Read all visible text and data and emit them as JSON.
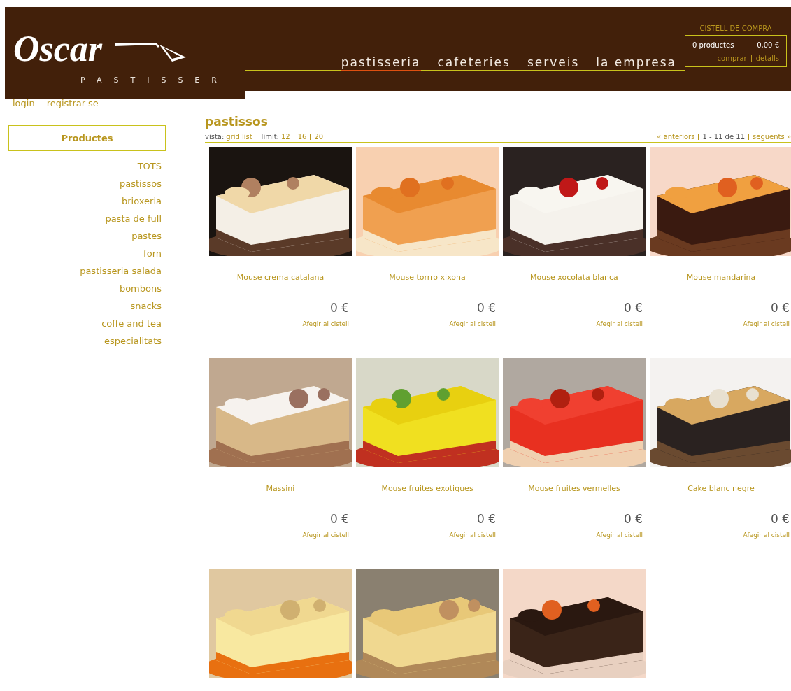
{
  "header": {
    "logo": {
      "name": "Oscar",
      "tagline": "PASTISSER"
    },
    "nav": [
      {
        "label": "pastisseria",
        "selected": true
      },
      {
        "label": "cafeteries",
        "selected": false
      },
      {
        "label": "serveis",
        "selected": false
      },
      {
        "label": "la empresa",
        "selected": false
      }
    ],
    "cart": {
      "title": "CISTELL DE COMPRA",
      "count": "0 productes",
      "total": "0,00 €",
      "links": [
        "comprar",
        "detalls"
      ]
    }
  },
  "account": [
    "login",
    "registrar-se"
  ],
  "sidebar": {
    "title": "Productes",
    "items": [
      "TOTS",
      "pastissos",
      "brioxeria",
      "pasta de full",
      "pastes",
      "forn",
      "pastisseria salada",
      "bombons",
      "snacks",
      "coffe and tea",
      "especialitats"
    ]
  },
  "content": {
    "title": "pastissos",
    "view_label": "vista:",
    "views": [
      "grid",
      "list"
    ],
    "limit_label": "limit:",
    "limits": [
      "12",
      "16",
      "20"
    ],
    "pager": {
      "prev": "« anteriors",
      "range": "1 - 11 de 11",
      "next": "següents »"
    },
    "products": [
      {
        "image": {
          "kind": "picture"
        },
        "name": "Mouse crema catalana",
        "price": "0 €",
        "action": "Afegir al cistell"
      },
      {
        "image": {
          "kind": "picture"
        },
        "name": "Mouse torrro xixona",
        "price": "0 €",
        "action": "Afegir al cistell"
      },
      {
        "image": {
          "kind": "picture"
        },
        "name": "Mouse xocolata blanca",
        "price": "0 €",
        "action": "Afegir al cistell"
      },
      {
        "image": {
          "kind": "picture"
        },
        "name": "Mouse mandarina",
        "price": "0 €",
        "action": "Afegir al cistell"
      },
      {
        "image": {
          "kind": "picture"
        },
        "name": "Massini",
        "price": "0 €",
        "action": "Afegir al cistell"
      },
      {
        "image": {
          "kind": "picture"
        },
        "name": "Mouse fruites exotiques",
        "price": "0 €",
        "action": "Afegir al cistell"
      },
      {
        "image": {
          "kind": "picture"
        },
        "name": "Mouse fruites vermelles",
        "price": "0 €",
        "action": "Afegir al cistell"
      },
      {
        "image": {
          "kind": "picture"
        },
        "name": "Cake blanc negre",
        "price": "0 €",
        "action": "Afegir al cistell"
      },
      {
        "image": {
          "kind": "picture"
        }
      },
      {
        "image": {
          "kind": "picture"
        }
      },
      {
        "image": {
          "kind": "picture"
        }
      }
    ]
  }
}
